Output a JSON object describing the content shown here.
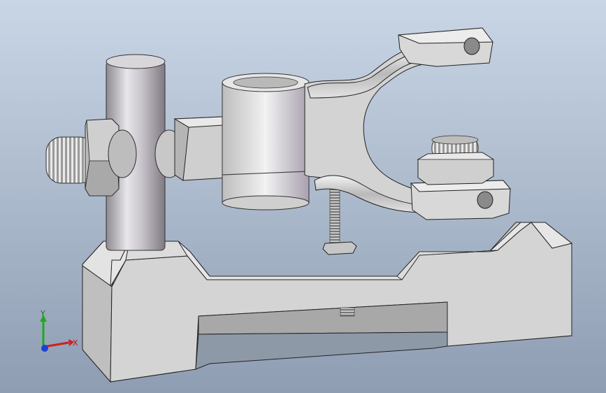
{
  "scene": {
    "description_visible": false,
    "background_top": "#c9d6e6",
    "background_bottom": "#8d9db2",
    "part_color": "#d6d6d6"
  },
  "triad": {
    "x_label": "X",
    "y_label": "Y",
    "x_color": "#d11f1f",
    "y_color": "#1faa1f",
    "z_color": "#1f3fd1"
  }
}
